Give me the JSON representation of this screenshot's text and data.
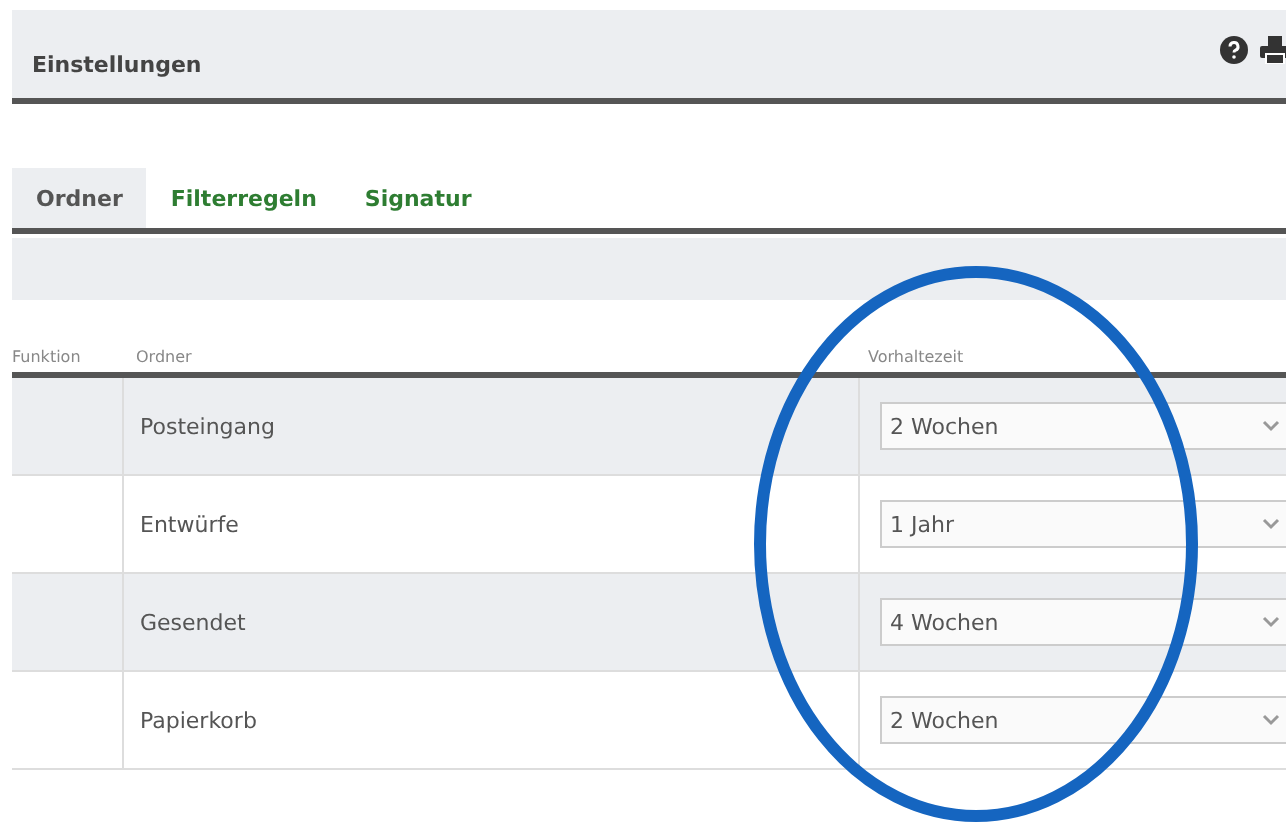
{
  "header": {
    "title": "Einstellungen"
  },
  "tabs": [
    {
      "label": "Ordner",
      "selected": true
    },
    {
      "label": "Filterregeln",
      "selected": false
    },
    {
      "label": "Signatur",
      "selected": false
    }
  ],
  "table": {
    "columns": [
      "Funktion",
      "Ordner",
      "Vorhaltezeit"
    ],
    "rows": [
      {
        "folder": "Posteingang",
        "retention": "2 Wochen"
      },
      {
        "folder": "Entwürfe",
        "retention": "1 Jahr"
      },
      {
        "folder": "Gesendet",
        "retention": "4 Wochen"
      },
      {
        "folder": "Papierkorb",
        "retention": "2 Wochen"
      }
    ]
  }
}
